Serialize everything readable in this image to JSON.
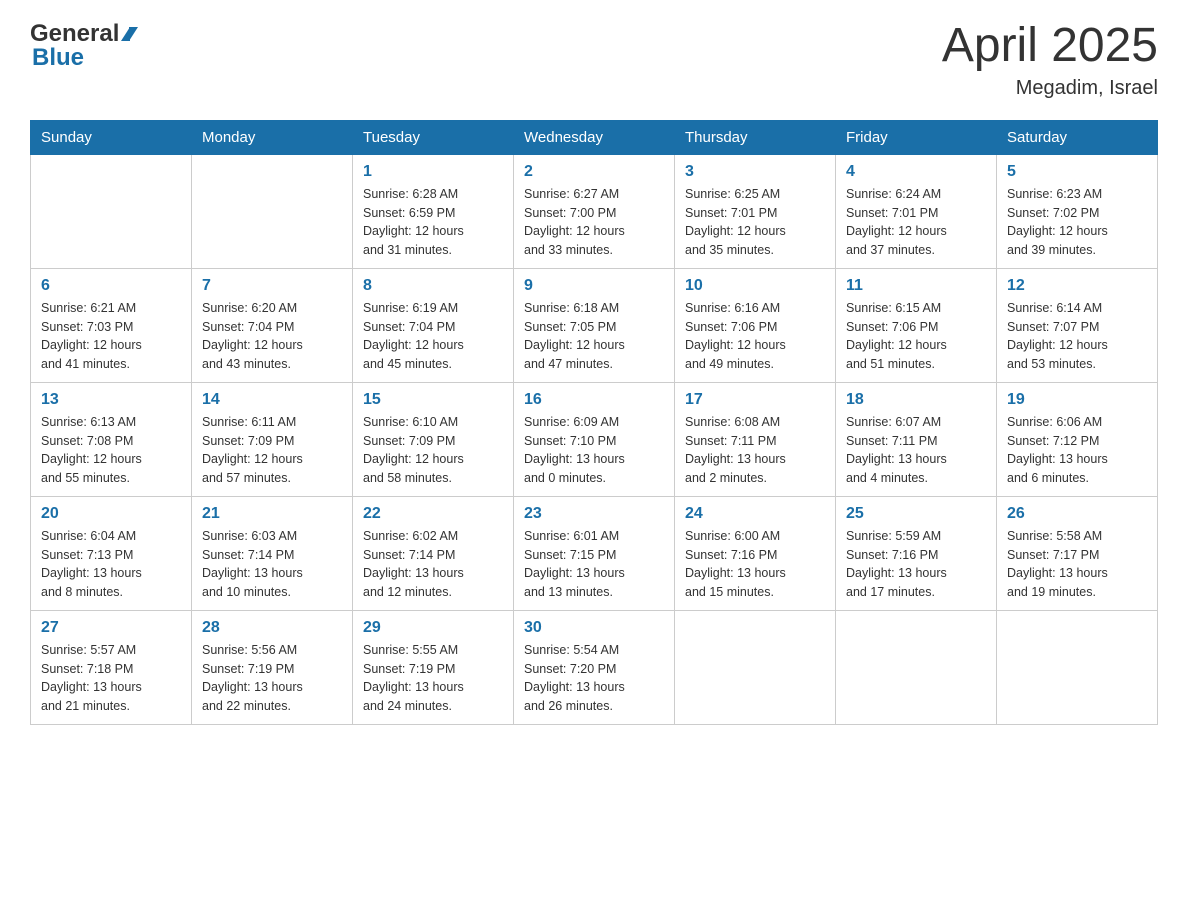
{
  "header": {
    "logo_general": "General",
    "logo_blue": "Blue",
    "month_title": "April 2025",
    "location": "Megadim, Israel"
  },
  "weekdays": [
    "Sunday",
    "Monday",
    "Tuesday",
    "Wednesday",
    "Thursday",
    "Friday",
    "Saturday"
  ],
  "weeks": [
    [
      {
        "day": "",
        "info": ""
      },
      {
        "day": "",
        "info": ""
      },
      {
        "day": "1",
        "info": "Sunrise: 6:28 AM\nSunset: 6:59 PM\nDaylight: 12 hours\nand 31 minutes."
      },
      {
        "day": "2",
        "info": "Sunrise: 6:27 AM\nSunset: 7:00 PM\nDaylight: 12 hours\nand 33 minutes."
      },
      {
        "day": "3",
        "info": "Sunrise: 6:25 AM\nSunset: 7:01 PM\nDaylight: 12 hours\nand 35 minutes."
      },
      {
        "day": "4",
        "info": "Sunrise: 6:24 AM\nSunset: 7:01 PM\nDaylight: 12 hours\nand 37 minutes."
      },
      {
        "day": "5",
        "info": "Sunrise: 6:23 AM\nSunset: 7:02 PM\nDaylight: 12 hours\nand 39 minutes."
      }
    ],
    [
      {
        "day": "6",
        "info": "Sunrise: 6:21 AM\nSunset: 7:03 PM\nDaylight: 12 hours\nand 41 minutes."
      },
      {
        "day": "7",
        "info": "Sunrise: 6:20 AM\nSunset: 7:04 PM\nDaylight: 12 hours\nand 43 minutes."
      },
      {
        "day": "8",
        "info": "Sunrise: 6:19 AM\nSunset: 7:04 PM\nDaylight: 12 hours\nand 45 minutes."
      },
      {
        "day": "9",
        "info": "Sunrise: 6:18 AM\nSunset: 7:05 PM\nDaylight: 12 hours\nand 47 minutes."
      },
      {
        "day": "10",
        "info": "Sunrise: 6:16 AM\nSunset: 7:06 PM\nDaylight: 12 hours\nand 49 minutes."
      },
      {
        "day": "11",
        "info": "Sunrise: 6:15 AM\nSunset: 7:06 PM\nDaylight: 12 hours\nand 51 minutes."
      },
      {
        "day": "12",
        "info": "Sunrise: 6:14 AM\nSunset: 7:07 PM\nDaylight: 12 hours\nand 53 minutes."
      }
    ],
    [
      {
        "day": "13",
        "info": "Sunrise: 6:13 AM\nSunset: 7:08 PM\nDaylight: 12 hours\nand 55 minutes."
      },
      {
        "day": "14",
        "info": "Sunrise: 6:11 AM\nSunset: 7:09 PM\nDaylight: 12 hours\nand 57 minutes."
      },
      {
        "day": "15",
        "info": "Sunrise: 6:10 AM\nSunset: 7:09 PM\nDaylight: 12 hours\nand 58 minutes."
      },
      {
        "day": "16",
        "info": "Sunrise: 6:09 AM\nSunset: 7:10 PM\nDaylight: 13 hours\nand 0 minutes."
      },
      {
        "day": "17",
        "info": "Sunrise: 6:08 AM\nSunset: 7:11 PM\nDaylight: 13 hours\nand 2 minutes."
      },
      {
        "day": "18",
        "info": "Sunrise: 6:07 AM\nSunset: 7:11 PM\nDaylight: 13 hours\nand 4 minutes."
      },
      {
        "day": "19",
        "info": "Sunrise: 6:06 AM\nSunset: 7:12 PM\nDaylight: 13 hours\nand 6 minutes."
      }
    ],
    [
      {
        "day": "20",
        "info": "Sunrise: 6:04 AM\nSunset: 7:13 PM\nDaylight: 13 hours\nand 8 minutes."
      },
      {
        "day": "21",
        "info": "Sunrise: 6:03 AM\nSunset: 7:14 PM\nDaylight: 13 hours\nand 10 minutes."
      },
      {
        "day": "22",
        "info": "Sunrise: 6:02 AM\nSunset: 7:14 PM\nDaylight: 13 hours\nand 12 minutes."
      },
      {
        "day": "23",
        "info": "Sunrise: 6:01 AM\nSunset: 7:15 PM\nDaylight: 13 hours\nand 13 minutes."
      },
      {
        "day": "24",
        "info": "Sunrise: 6:00 AM\nSunset: 7:16 PM\nDaylight: 13 hours\nand 15 minutes."
      },
      {
        "day": "25",
        "info": "Sunrise: 5:59 AM\nSunset: 7:16 PM\nDaylight: 13 hours\nand 17 minutes."
      },
      {
        "day": "26",
        "info": "Sunrise: 5:58 AM\nSunset: 7:17 PM\nDaylight: 13 hours\nand 19 minutes."
      }
    ],
    [
      {
        "day": "27",
        "info": "Sunrise: 5:57 AM\nSunset: 7:18 PM\nDaylight: 13 hours\nand 21 minutes."
      },
      {
        "day": "28",
        "info": "Sunrise: 5:56 AM\nSunset: 7:19 PM\nDaylight: 13 hours\nand 22 minutes."
      },
      {
        "day": "29",
        "info": "Sunrise: 5:55 AM\nSunset: 7:19 PM\nDaylight: 13 hours\nand 24 minutes."
      },
      {
        "day": "30",
        "info": "Sunrise: 5:54 AM\nSunset: 7:20 PM\nDaylight: 13 hours\nand 26 minutes."
      },
      {
        "day": "",
        "info": ""
      },
      {
        "day": "",
        "info": ""
      },
      {
        "day": "",
        "info": ""
      }
    ]
  ]
}
